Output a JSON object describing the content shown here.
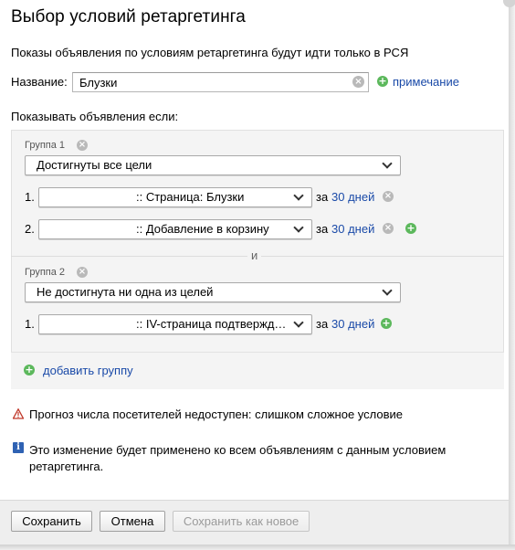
{
  "dialog": {
    "title": "Выбор условий ретаргетинга",
    "subtitle": "Показы объявления по условиям ретаргетинга будут идти только в РСЯ"
  },
  "name_field": {
    "label": "Название:",
    "value": "Блузки",
    "note_link": "примечание"
  },
  "show_if_label": "Показывать объявления если:",
  "groups": [
    {
      "label": "Группа 1",
      "mode": "Достигнуты все цели",
      "conditions": [
        {
          "num": "1.",
          "goal": ":: Страница: Блузки",
          "za": "за",
          "days": "30 дней"
        },
        {
          "num": "2.",
          "goal": ":: Добавление в корзину",
          "za": "за",
          "days": "30 дней"
        }
      ]
    },
    {
      "label": "Группа 2",
      "mode": "Не достигнута ни одна из целей",
      "conditions": [
        {
          "num": "1.",
          "goal": ":: IV-страница подтвержд…",
          "za": "за",
          "days": "30 дней"
        }
      ]
    }
  ],
  "and_separator": "и",
  "add_group_link": "добавить группу",
  "warning": "Прогноз числа посетителей недоступен: слишком сложное условие",
  "info": "Это изменение будет применено ко всем объявлениям с данным условием ретаргетинга.",
  "buttons": {
    "save": "Сохранить",
    "cancel": "Отмена",
    "save_as_new": "Сохранить как новое"
  },
  "colors": {
    "link": "#1a4aa8",
    "add_green": "#5cb85c",
    "warning_red": "#c0392b",
    "info_blue": "#2f62b3"
  }
}
